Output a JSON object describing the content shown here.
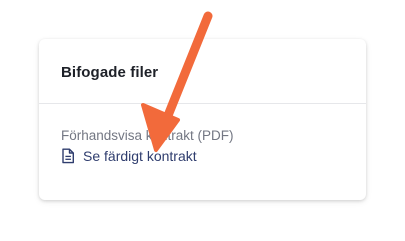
{
  "card": {
    "title": "Bifogade filer",
    "preview_label": "Förhandsvisa kontrakt (PDF)",
    "link_label": "Se färdigt kontrakt",
    "link_icon": "document-icon"
  },
  "annotation": {
    "arrow_color": "#f26a3b"
  }
}
